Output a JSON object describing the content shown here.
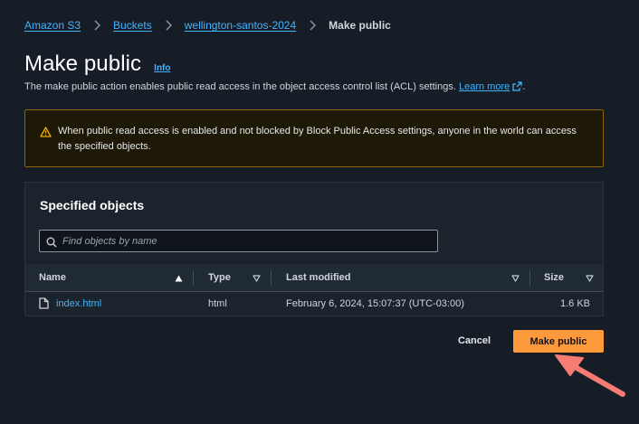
{
  "breadcrumb": {
    "items": [
      "Amazon S3",
      "Buckets",
      "wellington-santos-2024"
    ],
    "current": "Make public"
  },
  "header": {
    "title": "Make public",
    "info_label": "Info",
    "description_prefix": "The make public action enables public read access in the object access control list (ACL) settings.",
    "learn_more": "Learn more",
    "description_suffix": "."
  },
  "warning": {
    "text": "When public read access is enabled and not blocked by Block Public Access settings, anyone in the world can access the specified objects."
  },
  "objects_panel": {
    "title": "Specified objects",
    "search_placeholder": "Find objects by name",
    "columns": [
      "Name",
      "Type",
      "Last modified",
      "Size"
    ],
    "rows": [
      {
        "name": "index.html",
        "type": "html",
        "last_modified": "February 6, 2024, 15:07:37 (UTC-03:00)",
        "size": "1.6 KB"
      }
    ]
  },
  "actions": {
    "cancel_label": "Cancel",
    "primary_label": "Make public"
  },
  "colors": {
    "background": "#161d26",
    "link": "#42b4ff",
    "primary": "#ff9a3c",
    "warning_border": "#8d6605",
    "annotation_arrow": "#f47c73"
  },
  "icons": [
    "chevron-right-icon",
    "external-link-icon",
    "warning-icon",
    "search-icon",
    "sort-ascending-icon",
    "sort-descending-icon",
    "file-icon",
    "arrow-pointer-icon"
  ]
}
